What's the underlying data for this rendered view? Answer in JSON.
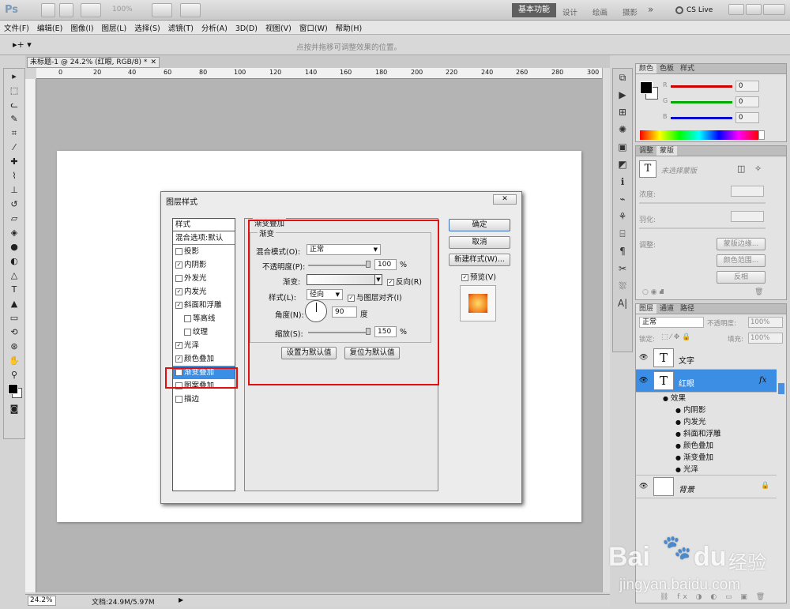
{
  "app": {
    "logo": "Ps",
    "zoom_select": "100%",
    "workspace_active": "基本功能",
    "workspace_others": [
      "设计",
      "绘画",
      "摄影"
    ],
    "overflow": "»",
    "cslive": "CS Live"
  },
  "menu": [
    "文件(F)",
    "编辑(E)",
    "图像(I)",
    "图层(L)",
    "选择(S)",
    "滤镜(T)",
    "分析(A)",
    "3D(D)",
    "视图(V)",
    "窗口(W)",
    "帮助(H)"
  ],
  "options_hint": "点按并拖移可调整效果的位置。",
  "document": {
    "tab_title": "未标题-1 @ 24.2% (红眼, RGB/8) *",
    "ruler_marks": [
      "0",
      "20",
      "40",
      "60",
      "80",
      "100",
      "120",
      "140",
      "160",
      "180",
      "200",
      "220",
      "240",
      "260",
      "280",
      "300"
    ],
    "zoom": "24.2%",
    "doc_size": "文档:24.9M/5.97M"
  },
  "color_panel": {
    "tabs": [
      "颜色",
      "色板",
      "样式"
    ],
    "channels": [
      {
        "name": "R",
        "value": "0",
        "color": "#cc0000"
      },
      {
        "name": "G",
        "value": "0",
        "color": "#00aa00"
      },
      {
        "name": "B",
        "value": "0",
        "color": "#0000cc"
      }
    ]
  },
  "adjust_panel": {
    "tabs": [
      "调整",
      "蒙版"
    ],
    "no_mask": "未选择蒙版",
    "density": "浓度:",
    "feather": "羽化:",
    "refine": "调整:",
    "btn_edge": "蒙版边缘...",
    "btn_range": "颜色范围...",
    "btn_invert": "反相"
  },
  "layers_panel": {
    "tabs": [
      "图层",
      "通道",
      "路径"
    ],
    "blend": "正常",
    "opacity_label": "不透明度:",
    "opacity": "100%",
    "lock_label": "锁定:",
    "fill_label": "填充:",
    "fill": "100%",
    "layers": [
      {
        "name": "文字",
        "thumb": "T"
      },
      {
        "name": "红眼",
        "thumb": "T",
        "fx": "fx"
      },
      {
        "name": "背景",
        "thumb": ""
      }
    ],
    "effects_label": "效果",
    "effects": [
      "内阴影",
      "内发光",
      "斜面和浮雕",
      "颜色叠加",
      "渐变叠加",
      "光泽"
    ]
  },
  "dialog": {
    "title": "图层样式",
    "styles_header": "样式",
    "blend_default": "混合选项:默认",
    "styles": [
      {
        "label": "投影",
        "checked": false,
        "sub": false
      },
      {
        "label": "内阴影",
        "checked": true,
        "sub": false
      },
      {
        "label": "外发光",
        "checked": false,
        "sub": false
      },
      {
        "label": "内发光",
        "checked": true,
        "sub": false
      },
      {
        "label": "斜面和浮雕",
        "checked": true,
        "sub": false
      },
      {
        "label": "等高线",
        "checked": false,
        "sub": true
      },
      {
        "label": "纹理",
        "checked": false,
        "sub": true
      },
      {
        "label": "光泽",
        "checked": true,
        "sub": false
      },
      {
        "label": "颜色叠加",
        "checked": true,
        "sub": false
      },
      {
        "label": "渐变叠加",
        "checked": true,
        "sub": false,
        "selected": true
      },
      {
        "label": "图案叠加",
        "checked": false,
        "sub": false
      },
      {
        "label": "描边",
        "checked": false,
        "sub": false
      }
    ],
    "section_title": "渐变叠加",
    "group_title": "渐变",
    "blend_mode_label": "混合模式(O):",
    "blend_mode": "正常",
    "opacity_label": "不透明度(P):",
    "opacity": "100",
    "percent": "%",
    "gradient_label": "渐变:",
    "reverse_label": "反向(R)",
    "style_label": "样式(L):",
    "style_value": "径向",
    "align_label": "与图层对齐(I)",
    "angle_label": "角度(N):",
    "angle": "90",
    "degree": "度",
    "scale_label": "缩放(S):",
    "scale": "150",
    "btn_set_default": "设置为默认值",
    "btn_reset_default": "复位为默认值",
    "btn_ok": "确定",
    "btn_cancel": "取消",
    "btn_new_style": "新建样式(W)...",
    "preview_label": "预览(V)"
  },
  "watermark": {
    "brand": "Bai",
    "brand2": "du",
    "cn": "经验",
    "url": "jingyan.baidu.com"
  }
}
